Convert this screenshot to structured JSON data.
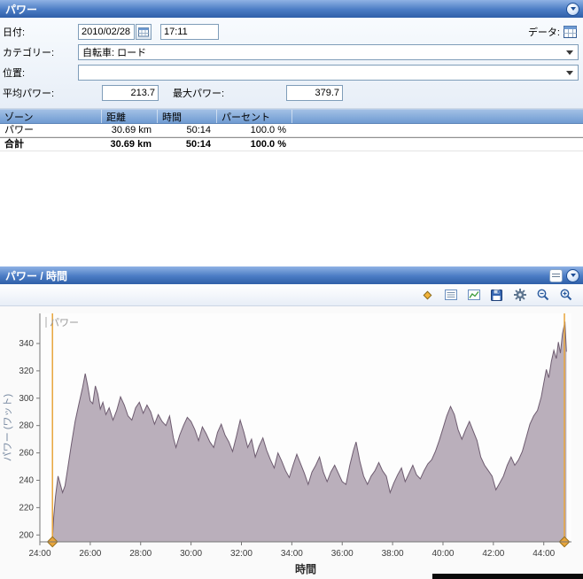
{
  "panel1": {
    "title": "パワー",
    "date_label": "日付:",
    "date_value": "2010/02/28",
    "time_value": "17:11",
    "data_label": "データ:",
    "category_label": "カテゴリー:",
    "category_value": "自転車: ロード",
    "location_label": "位置:",
    "location_value": "",
    "avg_power_label": "平均パワー:",
    "avg_power_value": "213.7",
    "max_power_label": "最大パワー:",
    "max_power_value": "379.7",
    "table": {
      "headers": [
        "ゾーン",
        "距離",
        "時間",
        "パーセント"
      ],
      "rows": [
        {
          "zone": "パワー",
          "distance": "30.69 km",
          "time": "50:14",
          "percent": "100.0 %"
        },
        {
          "zone": "合計",
          "distance": "30.69 km",
          "time": "50:14",
          "percent": "100.0 %"
        }
      ]
    }
  },
  "panel2": {
    "title": "パワー / 時間",
    "icons": {
      "marker": "orange-diamond",
      "table": "list-grid",
      "chart": "mini-line-chart",
      "save": "floppy-disk",
      "settings": "gear",
      "zoom_out": "magnifier-minus",
      "zoom_in": "magnifier-plus",
      "layout": "panel-lines",
      "collapse": "chevron-down-circle"
    }
  },
  "chart_data": {
    "type": "area",
    "title": "パワー / 時間",
    "series_name": "パワー",
    "xlabel": "時間",
    "ylabel": "パワー (ワット)",
    "x_domain": [
      24,
      45.1
    ],
    "ylim": [
      195,
      362
    ],
    "grid": false,
    "legend_position": "top-left",
    "x_ticks": [
      [
        24,
        "24:00"
      ],
      [
        26,
        "26:00"
      ],
      [
        28,
        "28:00"
      ],
      [
        30,
        "30:00"
      ],
      [
        32,
        "32:00"
      ],
      [
        34,
        "34:00"
      ],
      [
        36,
        "36:00"
      ],
      [
        38,
        "38:00"
      ],
      [
        40,
        "40:00"
      ],
      [
        42,
        "42:00"
      ],
      [
        44,
        "44:00"
      ]
    ],
    "y_ticks": [
      200,
      220,
      240,
      260,
      280,
      300,
      320,
      340
    ],
    "fill_color": "#b3a6b4",
    "line_color": "#6e5c70",
    "marker_color": "#e8a53c",
    "marker_edge_color": "#9a7018",
    "selection_markers_minutes": [
      24.5,
      44.82
    ],
    "points": [
      [
        24.5,
        197
      ],
      [
        24.55,
        213
      ],
      [
        24.62,
        228
      ],
      [
        24.72,
        243
      ],
      [
        24.8,
        238
      ],
      [
        24.9,
        231
      ],
      [
        25.0,
        236
      ],
      [
        25.1,
        248
      ],
      [
        25.25,
        266
      ],
      [
        25.4,
        283
      ],
      [
        25.55,
        296
      ],
      [
        25.7,
        308
      ],
      [
        25.8,
        318
      ],
      [
        25.9,
        309
      ],
      [
        26.0,
        298
      ],
      [
        26.1,
        296
      ],
      [
        26.2,
        309
      ],
      [
        26.3,
        303
      ],
      [
        26.4,
        292
      ],
      [
        26.5,
        297
      ],
      [
        26.62,
        288
      ],
      [
        26.75,
        293
      ],
      [
        26.9,
        284
      ],
      [
        27.05,
        291
      ],
      [
        27.2,
        301
      ],
      [
        27.35,
        295
      ],
      [
        27.5,
        287
      ],
      [
        27.65,
        284
      ],
      [
        27.8,
        293
      ],
      [
        27.95,
        297
      ],
      [
        28.1,
        289
      ],
      [
        28.25,
        295
      ],
      [
        28.4,
        290
      ],
      [
        28.55,
        281
      ],
      [
        28.7,
        288
      ],
      [
        28.85,
        283
      ],
      [
        29.0,
        280
      ],
      [
        29.15,
        287
      ],
      [
        29.3,
        271
      ],
      [
        29.4,
        264
      ],
      [
        29.55,
        273
      ],
      [
        29.7,
        280
      ],
      [
        29.85,
        286
      ],
      [
        30.0,
        283
      ],
      [
        30.15,
        277
      ],
      [
        30.3,
        269
      ],
      [
        30.45,
        279
      ],
      [
        30.6,
        274
      ],
      [
        30.75,
        268
      ],
      [
        30.9,
        264
      ],
      [
        31.05,
        275
      ],
      [
        31.2,
        281
      ],
      [
        31.35,
        273
      ],
      [
        31.5,
        268
      ],
      [
        31.65,
        261
      ],
      [
        31.8,
        272
      ],
      [
        31.95,
        284
      ],
      [
        32.1,
        275
      ],
      [
        32.25,
        264
      ],
      [
        32.4,
        270
      ],
      [
        32.55,
        257
      ],
      [
        32.7,
        265
      ],
      [
        32.85,
        271
      ],
      [
        33.0,
        262
      ],
      [
        33.15,
        255
      ],
      [
        33.3,
        249
      ],
      [
        33.45,
        260
      ],
      [
        33.6,
        254
      ],
      [
        33.75,
        247
      ],
      [
        33.9,
        242
      ],
      [
        34.05,
        251
      ],
      [
        34.2,
        259
      ],
      [
        34.35,
        252
      ],
      [
        34.5,
        245
      ],
      [
        34.65,
        237
      ],
      [
        34.8,
        246
      ],
      [
        34.95,
        251
      ],
      [
        35.1,
        257
      ],
      [
        35.25,
        246
      ],
      [
        35.4,
        239
      ],
      [
        35.55,
        246
      ],
      [
        35.7,
        251
      ],
      [
        35.85,
        245
      ],
      [
        36.0,
        239
      ],
      [
        36.15,
        237
      ],
      [
        36.3,
        251
      ],
      [
        36.45,
        262
      ],
      [
        36.55,
        268
      ],
      [
        36.7,
        254
      ],
      [
        36.85,
        243
      ],
      [
        37.0,
        237
      ],
      [
        37.15,
        243
      ],
      [
        37.3,
        247
      ],
      [
        37.45,
        253
      ],
      [
        37.6,
        247
      ],
      [
        37.75,
        243
      ],
      [
        37.9,
        231
      ],
      [
        38.05,
        238
      ],
      [
        38.2,
        244
      ],
      [
        38.35,
        249
      ],
      [
        38.5,
        239
      ],
      [
        38.65,
        245
      ],
      [
        38.8,
        251
      ],
      [
        38.95,
        244
      ],
      [
        39.1,
        241
      ],
      [
        39.25,
        247
      ],
      [
        39.4,
        252
      ],
      [
        39.55,
        255
      ],
      [
        39.7,
        261
      ],
      [
        39.85,
        269
      ],
      [
        40.0,
        278
      ],
      [
        40.15,
        287
      ],
      [
        40.3,
        294
      ],
      [
        40.45,
        288
      ],
      [
        40.6,
        277
      ],
      [
        40.75,
        270
      ],
      [
        40.9,
        277
      ],
      [
        41.05,
        283
      ],
      [
        41.2,
        276
      ],
      [
        41.35,
        269
      ],
      [
        41.5,
        257
      ],
      [
        41.65,
        251
      ],
      [
        41.8,
        247
      ],
      [
        41.95,
        243
      ],
      [
        42.1,
        233
      ],
      [
        42.25,
        238
      ],
      [
        42.4,
        243
      ],
      [
        42.55,
        251
      ],
      [
        42.7,
        257
      ],
      [
        42.85,
        251
      ],
      [
        43.0,
        255
      ],
      [
        43.15,
        261
      ],
      [
        43.3,
        271
      ],
      [
        43.45,
        281
      ],
      [
        43.6,
        287
      ],
      [
        43.75,
        291
      ],
      [
        43.9,
        301
      ],
      [
        44.0,
        311
      ],
      [
        44.1,
        321
      ],
      [
        44.2,
        315
      ],
      [
        44.3,
        327
      ],
      [
        44.4,
        335
      ],
      [
        44.5,
        329
      ],
      [
        44.58,
        341
      ],
      [
        44.66,
        333
      ],
      [
        44.74,
        347
      ],
      [
        44.84,
        356
      ],
      [
        44.9,
        334
      ]
    ]
  }
}
